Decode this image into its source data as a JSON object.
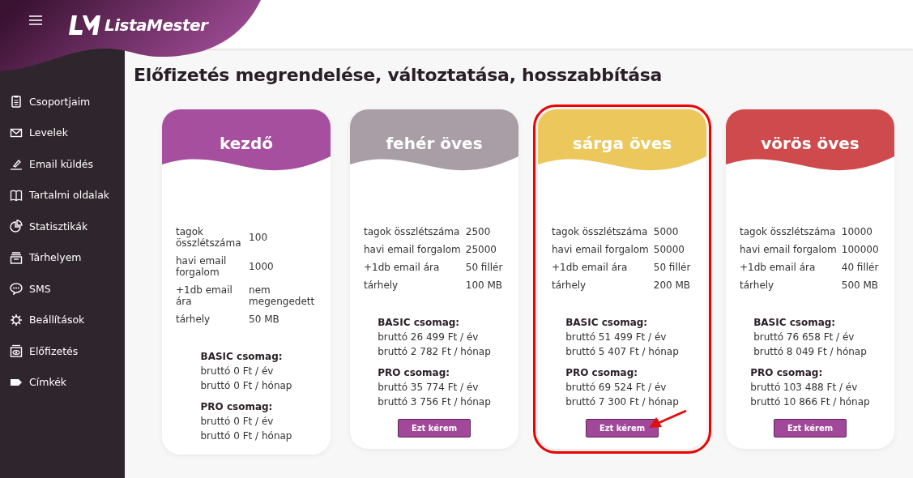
{
  "header": {
    "logo": "ListaMester"
  },
  "sidebar": {
    "items": [
      {
        "label": "Csoportjaim"
      },
      {
        "label": "Levelek"
      },
      {
        "label": "Email küldés"
      },
      {
        "label": "Tartalmi oldalak"
      },
      {
        "label": "Statisztikák"
      },
      {
        "label": "Tárhelyem"
      },
      {
        "label": "SMS"
      },
      {
        "label": "Beállítások"
      },
      {
        "label": "Előfizetés"
      },
      {
        "label": "Címkék"
      }
    ]
  },
  "page_title": "Előfizetés megrendelése, változtatása, hosszabbítása",
  "plans": [
    {
      "name": "kezdő",
      "color": "#a64f9f",
      "highlighted": false,
      "specs": [
        {
          "label": "tagok összlétszáma",
          "value": "100"
        },
        {
          "label": "havi email forgalom",
          "value": "1000"
        },
        {
          "label": "+1db email ára",
          "value": "nem megengedett"
        },
        {
          "label": "tárhely",
          "value": "50 MB"
        }
      ],
      "packages": [
        {
          "name": "BASIC csomag:",
          "prices": [
            "bruttó 0 Ft / év",
            "bruttó 0 Ft / hónap"
          ]
        },
        {
          "name": "PRO csomag:",
          "prices": [
            "bruttó 0 Ft / év",
            "bruttó 0 Ft / hónap"
          ]
        }
      ]
    },
    {
      "name": "fehér öves",
      "color": "#aa9ea6",
      "highlighted": false,
      "specs": [
        {
          "label": "tagok összlétszáma",
          "value": "2500"
        },
        {
          "label": "havi email forgalom",
          "value": "25000"
        },
        {
          "label": "+1db email ára",
          "value": "50 fillér"
        },
        {
          "label": "tárhely",
          "value": "100 MB"
        }
      ],
      "packages": [
        {
          "name": "BASIC csomag:",
          "prices": [
            "bruttó 26 499 Ft / év",
            "bruttó 2 782 Ft / hónap"
          ]
        },
        {
          "name": "PRO csomag:",
          "prices": [
            "bruttó 35 774 Ft / év",
            "bruttó 3 756 Ft / hónap"
          ]
        }
      ],
      "button": "Ezt kérem"
    },
    {
      "name": "sárga öves",
      "color": "#ebc75c",
      "highlighted": true,
      "specs": [
        {
          "label": "tagok összlétszáma",
          "value": "5000"
        },
        {
          "label": "havi email forgalom",
          "value": "50000"
        },
        {
          "label": "+1db email ára",
          "value": "50 fillér"
        },
        {
          "label": "tárhely",
          "value": "200 MB"
        }
      ],
      "packages": [
        {
          "name": "BASIC csomag:",
          "prices": [
            "bruttó 51 499 Ft / év",
            "bruttó 5 407 Ft / hónap"
          ]
        },
        {
          "name": "PRO csomag:",
          "prices": [
            "bruttó 69 524 Ft / év",
            "bruttó 7 300 Ft / hónap"
          ]
        }
      ],
      "button": "Ezt kérem"
    },
    {
      "name": "vörös öves",
      "color": "#cf4a4c",
      "highlighted": false,
      "specs": [
        {
          "label": "tagok összlétszáma",
          "value": "10000"
        },
        {
          "label": "havi email forgalom",
          "value": "100000"
        },
        {
          "label": "+1db email ára",
          "value": "40 fillér"
        },
        {
          "label": "tárhely",
          "value": "500 MB"
        }
      ],
      "packages": [
        {
          "name": "BASIC csomag:",
          "prices": [
            "bruttó 76 658 Ft / év",
            "bruttó 8 049 Ft / hónap"
          ]
        },
        {
          "name": "PRO csomag:",
          "prices": [
            "bruttó 103 488 Ft / év",
            "bruttó 10 866 Ft / hónap"
          ]
        }
      ],
      "button": "Ezt kérem"
    }
  ]
}
